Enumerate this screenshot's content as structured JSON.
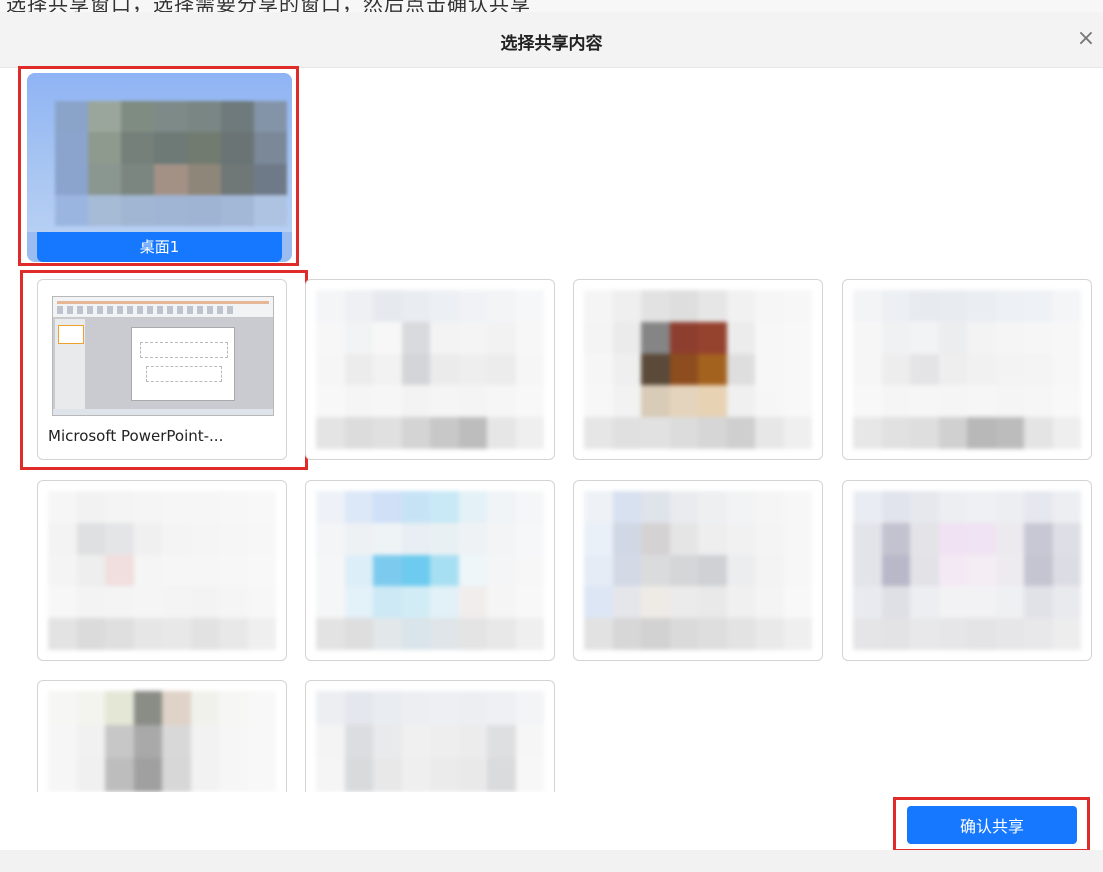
{
  "top_strip": {
    "text": "选择共享窗口，选择需要分享的窗口，然后点击确认共享"
  },
  "dialog": {
    "title": "选择共享内容",
    "close_icon": "close-icon",
    "close_glyph": "×"
  },
  "sources": [
    {
      "type": "desktop",
      "label": "桌面1",
      "selected": true
    },
    {
      "type": "window",
      "label": "Microsoft PowerPoint-...",
      "app": "Microsoft PowerPoint",
      "highlighted": true
    },
    {
      "type": "window",
      "label": "",
      "blurred": true
    },
    {
      "type": "window",
      "label": "",
      "blurred": true
    },
    {
      "type": "window",
      "label": "",
      "blurred": true
    },
    {
      "type": "window",
      "label": "",
      "blurred": true
    },
    {
      "type": "window",
      "label": "",
      "blurred": true
    },
    {
      "type": "window",
      "label": "",
      "blurred": true
    },
    {
      "type": "window",
      "label": "",
      "blurred": true
    },
    {
      "type": "window",
      "label": "",
      "blurred": true
    },
    {
      "type": "window",
      "label": "",
      "blurred": true
    }
  ],
  "confirm_button": {
    "label": "确认共享"
  },
  "colors": {
    "accent": "#1677ff",
    "highlight": "#e02b2b",
    "card_border": "#d4d4d4"
  }
}
